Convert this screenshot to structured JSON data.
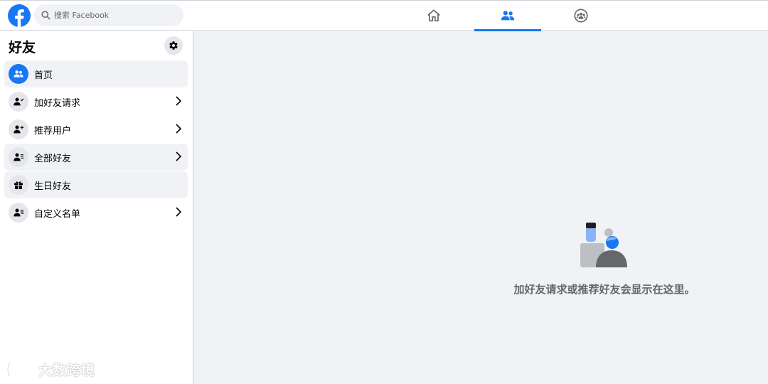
{
  "topbar": {
    "logo_icon": "facebook-logo",
    "search_placeholder": "搜索 Facebook",
    "tabs": [
      {
        "name": "home",
        "icon": "home-icon",
        "active": false
      },
      {
        "name": "friends",
        "icon": "friends-icon",
        "active": true
      },
      {
        "name": "groups",
        "icon": "groups-icon",
        "active": false
      }
    ]
  },
  "sidebar": {
    "title": "好友",
    "settings_icon": "gear-icon",
    "items": [
      {
        "label": "首页",
        "icon": "friends-icon",
        "chevron": false,
        "selected": true
      },
      {
        "label": "加好友请求",
        "icon": "person-add-icon",
        "chevron": true,
        "selected": false
      },
      {
        "label": "推荐用户",
        "icon": "person-plus-icon",
        "chevron": true,
        "selected": false
      },
      {
        "label": "全部好友",
        "icon": "person-list-icon",
        "chevron": true,
        "selected": false
      },
      {
        "label": "生日好友",
        "icon": "gift-icon",
        "chevron": false,
        "selected": false
      },
      {
        "label": "自定义名单",
        "icon": "person-list-icon",
        "chevron": true,
        "selected": false
      }
    ]
  },
  "main": {
    "empty_message": "加好友请求或推荐好友会显示在这里。"
  },
  "watermark": {
    "text": "大数跨境"
  },
  "colors": {
    "brand": "#1877f2",
    "background": "#f0f2f5",
    "secondary_text": "#65676b"
  }
}
